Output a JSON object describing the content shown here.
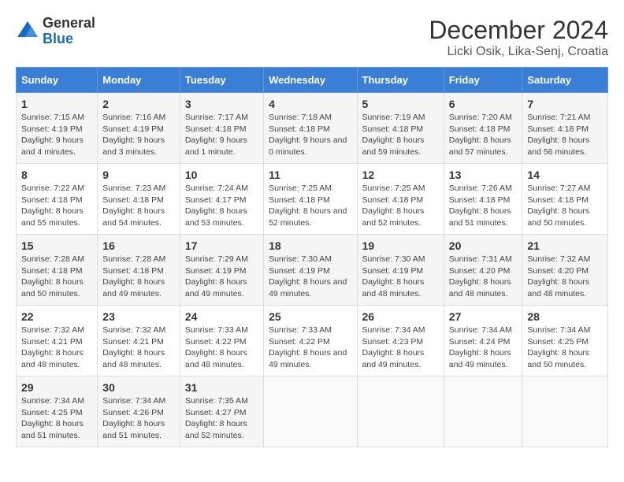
{
  "logo": {
    "general": "General",
    "blue": "Blue"
  },
  "title": "December 2024",
  "location": "Licki Osik, Lika-Senj, Croatia",
  "days_of_week": [
    "Sunday",
    "Monday",
    "Tuesday",
    "Wednesday",
    "Thursday",
    "Friday",
    "Saturday"
  ],
  "weeks": [
    [
      {
        "day": "1",
        "sunrise": "7:15 AM",
        "sunset": "4:19 PM",
        "daylight": "9 hours and 4 minutes."
      },
      {
        "day": "2",
        "sunrise": "7:16 AM",
        "sunset": "4:19 PM",
        "daylight": "9 hours and 3 minutes."
      },
      {
        "day": "3",
        "sunrise": "7:17 AM",
        "sunset": "4:18 PM",
        "daylight": "9 hours and 1 minute."
      },
      {
        "day": "4",
        "sunrise": "7:18 AM",
        "sunset": "4:18 PM",
        "daylight": "9 hours and 0 minutes."
      },
      {
        "day": "5",
        "sunrise": "7:19 AM",
        "sunset": "4:18 PM",
        "daylight": "8 hours and 59 minutes."
      },
      {
        "day": "6",
        "sunrise": "7:20 AM",
        "sunset": "4:18 PM",
        "daylight": "8 hours and 57 minutes."
      },
      {
        "day": "7",
        "sunrise": "7:21 AM",
        "sunset": "4:18 PM",
        "daylight": "8 hours and 56 minutes."
      }
    ],
    [
      {
        "day": "8",
        "sunrise": "7:22 AM",
        "sunset": "4:18 PM",
        "daylight": "8 hours and 55 minutes."
      },
      {
        "day": "9",
        "sunrise": "7:23 AM",
        "sunset": "4:18 PM",
        "daylight": "8 hours and 54 minutes."
      },
      {
        "day": "10",
        "sunrise": "7:24 AM",
        "sunset": "4:17 PM",
        "daylight": "8 hours and 53 minutes."
      },
      {
        "day": "11",
        "sunrise": "7:25 AM",
        "sunset": "4:18 PM",
        "daylight": "8 hours and 52 minutes."
      },
      {
        "day": "12",
        "sunrise": "7:25 AM",
        "sunset": "4:18 PM",
        "daylight": "8 hours and 52 minutes."
      },
      {
        "day": "13",
        "sunrise": "7:26 AM",
        "sunset": "4:18 PM",
        "daylight": "8 hours and 51 minutes."
      },
      {
        "day": "14",
        "sunrise": "7:27 AM",
        "sunset": "4:18 PM",
        "daylight": "8 hours and 50 minutes."
      }
    ],
    [
      {
        "day": "15",
        "sunrise": "7:28 AM",
        "sunset": "4:18 PM",
        "daylight": "8 hours and 50 minutes."
      },
      {
        "day": "16",
        "sunrise": "7:28 AM",
        "sunset": "4:18 PM",
        "daylight": "8 hours and 49 minutes."
      },
      {
        "day": "17",
        "sunrise": "7:29 AM",
        "sunset": "4:19 PM",
        "daylight": "8 hours and 49 minutes."
      },
      {
        "day": "18",
        "sunrise": "7:30 AM",
        "sunset": "4:19 PM",
        "daylight": "8 hours and 49 minutes."
      },
      {
        "day": "19",
        "sunrise": "7:30 AM",
        "sunset": "4:19 PM",
        "daylight": "8 hours and 48 minutes."
      },
      {
        "day": "20",
        "sunrise": "7:31 AM",
        "sunset": "4:20 PM",
        "daylight": "8 hours and 48 minutes."
      },
      {
        "day": "21",
        "sunrise": "7:32 AM",
        "sunset": "4:20 PM",
        "daylight": "8 hours and 48 minutes."
      }
    ],
    [
      {
        "day": "22",
        "sunrise": "7:32 AM",
        "sunset": "4:21 PM",
        "daylight": "8 hours and 48 minutes."
      },
      {
        "day": "23",
        "sunrise": "7:32 AM",
        "sunset": "4:21 PM",
        "daylight": "8 hours and 48 minutes."
      },
      {
        "day": "24",
        "sunrise": "7:33 AM",
        "sunset": "4:22 PM",
        "daylight": "8 hours and 48 minutes."
      },
      {
        "day": "25",
        "sunrise": "7:33 AM",
        "sunset": "4:22 PM",
        "daylight": "8 hours and 49 minutes."
      },
      {
        "day": "26",
        "sunrise": "7:34 AM",
        "sunset": "4:23 PM",
        "daylight": "8 hours and 49 minutes."
      },
      {
        "day": "27",
        "sunrise": "7:34 AM",
        "sunset": "4:24 PM",
        "daylight": "8 hours and 49 minutes."
      },
      {
        "day": "28",
        "sunrise": "7:34 AM",
        "sunset": "4:25 PM",
        "daylight": "8 hours and 50 minutes."
      }
    ],
    [
      {
        "day": "29",
        "sunrise": "7:34 AM",
        "sunset": "4:25 PM",
        "daylight": "8 hours and 51 minutes."
      },
      {
        "day": "30",
        "sunrise": "7:34 AM",
        "sunset": "4:26 PM",
        "daylight": "8 hours and 51 minutes."
      },
      {
        "day": "31",
        "sunrise": "7:35 AM",
        "sunset": "4:27 PM",
        "daylight": "8 hours and 52 minutes."
      },
      null,
      null,
      null,
      null
    ]
  ]
}
